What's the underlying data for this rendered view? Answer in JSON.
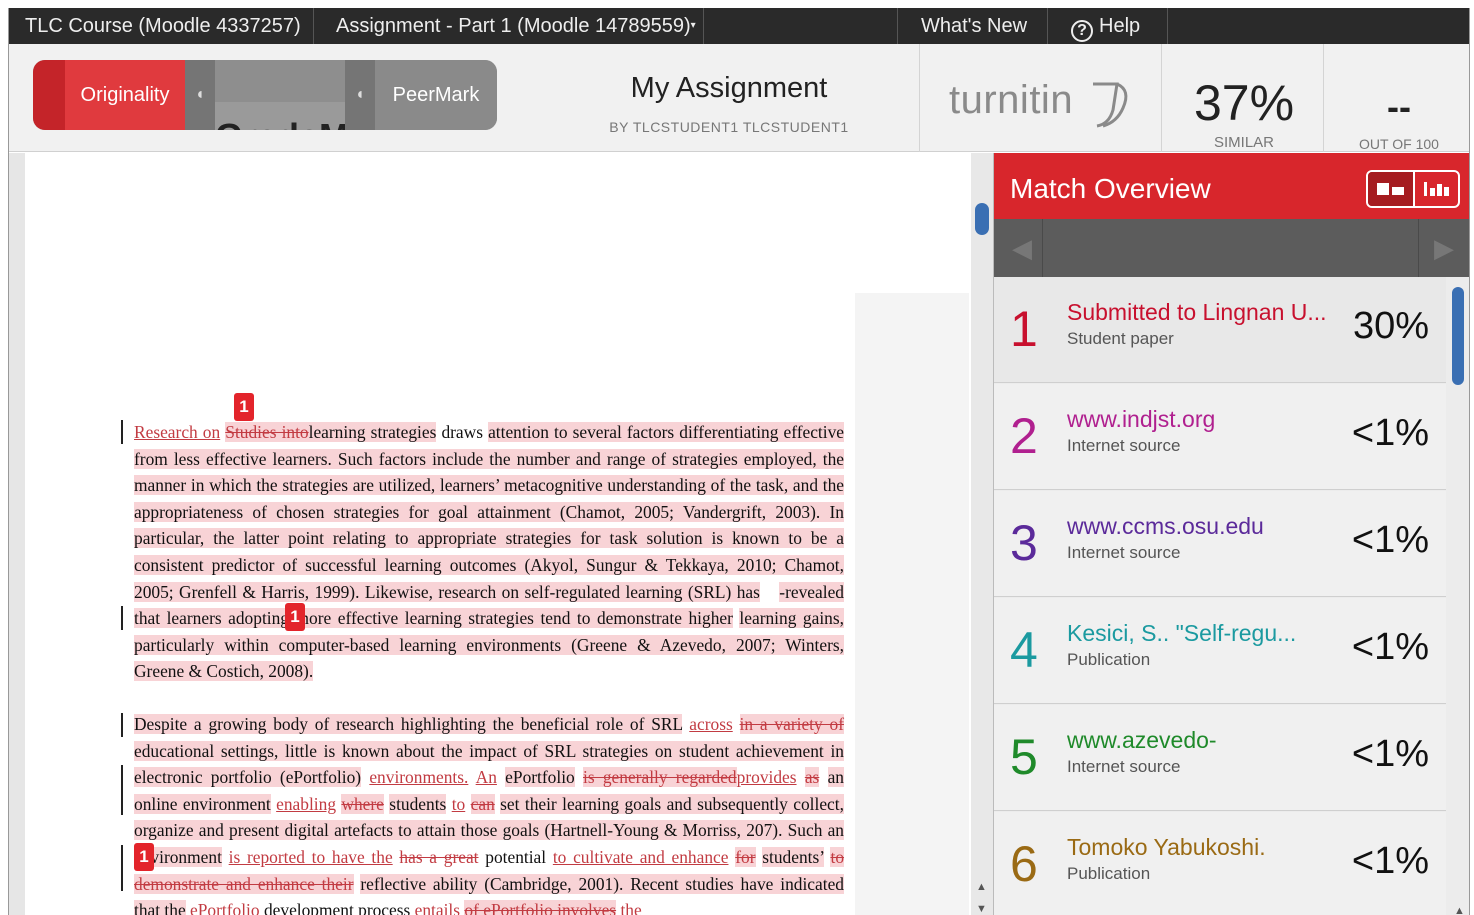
{
  "topbar": {
    "course": "TLC Course (Moodle 4337257)",
    "assignment_menu": "Assignment - Part 1 (Moodle 14789559)",
    "whats_new": "What's New",
    "help": "Help"
  },
  "modes": {
    "originality": "Originality",
    "grademark": "GradeMark",
    "peermark": "PeerMark",
    "active": "Originality"
  },
  "assignment": {
    "title": "My Assignment",
    "by": "BY TLCSTUDENT1 TLCSTUDENT1"
  },
  "logo": {
    "text": "turnitin"
  },
  "similarity": {
    "value": "37%",
    "label": "SIMILAR"
  },
  "grade": {
    "value": "--",
    "label": "OUT OF 100"
  },
  "document": {
    "p1": {
      "a1": "Research on",
      "a2": "Studies into",
      "a3": "learning strategies",
      "a4": "draws",
      "a5": "attention to several factors differentiating effective from less effective learners. Such factors include the number and range of strategies employed, the manner in which the strategies are utilized, learners’ metacognitive understanding of the task, and the appropriateness of chosen strategies for goal attainment (Chamot, 2005; Vandergrift, 2003). In particular, the latter point relating to appropriate strategies for task solution is known to be a consistent predictor of successful learning outcomes (Akyol, Sungur & Tekkaya, 2010; Chamot, 2005; Grenfell & Harris, 1999). Likewise, research on self-regulated learning (SRL) has",
      "a6": "-revealed that learners adopting more effective learning strategies tend to demonstrate higher",
      "a7": "learning gains, particularly within computer-based learning environments (Greene & Azevedo, 2007; Winters, Greene & Costich, 2008)."
    },
    "p2": {
      "b1": "Despite a growing body of research highlighting the beneficial role of SRL",
      "b2": "across",
      "b3": "in a variety of",
      "b4": "educational settings, little is known about the impact of SRL strategies on student achievement in electronic portfolio (ePortfolio)",
      "b5": "environments.",
      "b6": "An",
      "b7": "ePortfolio",
      "b8": "is generally regarded",
      "b9": "provides",
      "b10": "as",
      "b11": "an online environment",
      "b12": "enabling",
      "b13": "where",
      "b14": "students",
      "b15": "to",
      "b16": "can",
      "b17": "set their learning goals and subsequently collect, organize and present digital artefacts to attain those goals (Hartnell-Young & Morriss, 2",
      "b18": "07). Such an environment",
      "b19": "is reported to have the",
      "b20": "has a great",
      "b21": "potential",
      "b22": "to cultivate and enhance",
      "b23": "for",
      "b24": "students’",
      "b25": "to demonstrate and enhance their",
      "b26": "reflective ability (Cambridge, 2001). Recent studies have indicated that the",
      "b27": "ePortfolio",
      "b28": "development process",
      "b29": "entails",
      "b30": "of ePortfolio involves",
      "b31": "the"
    },
    "markers": [
      "1",
      "1",
      "1"
    ]
  },
  "match_overview": {
    "title": "Match Overview",
    "matches": [
      {
        "rank": "1",
        "name": "Submitted to Lingnan U...",
        "type": "Student paper",
        "percent": "30%",
        "color": "#c8102e"
      },
      {
        "rank": "2",
        "name": "www.indjst.org",
        "type": "Internet source",
        "percent": "<1%",
        "color": "#b0208f"
      },
      {
        "rank": "3",
        "name": "www.ccms.osu.edu",
        "type": "Internet source",
        "percent": "<1%",
        "color": "#5b2a9a"
      },
      {
        "rank": "4",
        "name": "Kesici, S.. \"Self-regu...",
        "type": "Publication",
        "percent": "<1%",
        "color": "#1b9aa0"
      },
      {
        "rank": "5",
        "name": "www.azevedo-",
        "type": "Internet source",
        "percent": "<1%",
        "color": "#1f8a2a"
      },
      {
        "rank": "6",
        "name": "Tomoko Yabukoshi.",
        "type": "Publication",
        "percent": "<1%",
        "color": "#9a6a14"
      }
    ]
  },
  "icons": {
    "help": "help-circle-icon",
    "dropdown": "chevron-down-icon",
    "prev": "chevron-left-icon",
    "next": "chevron-right-icon",
    "view_top": "view-top-sources-icon",
    "view_chart": "view-bar-chart-icon"
  }
}
